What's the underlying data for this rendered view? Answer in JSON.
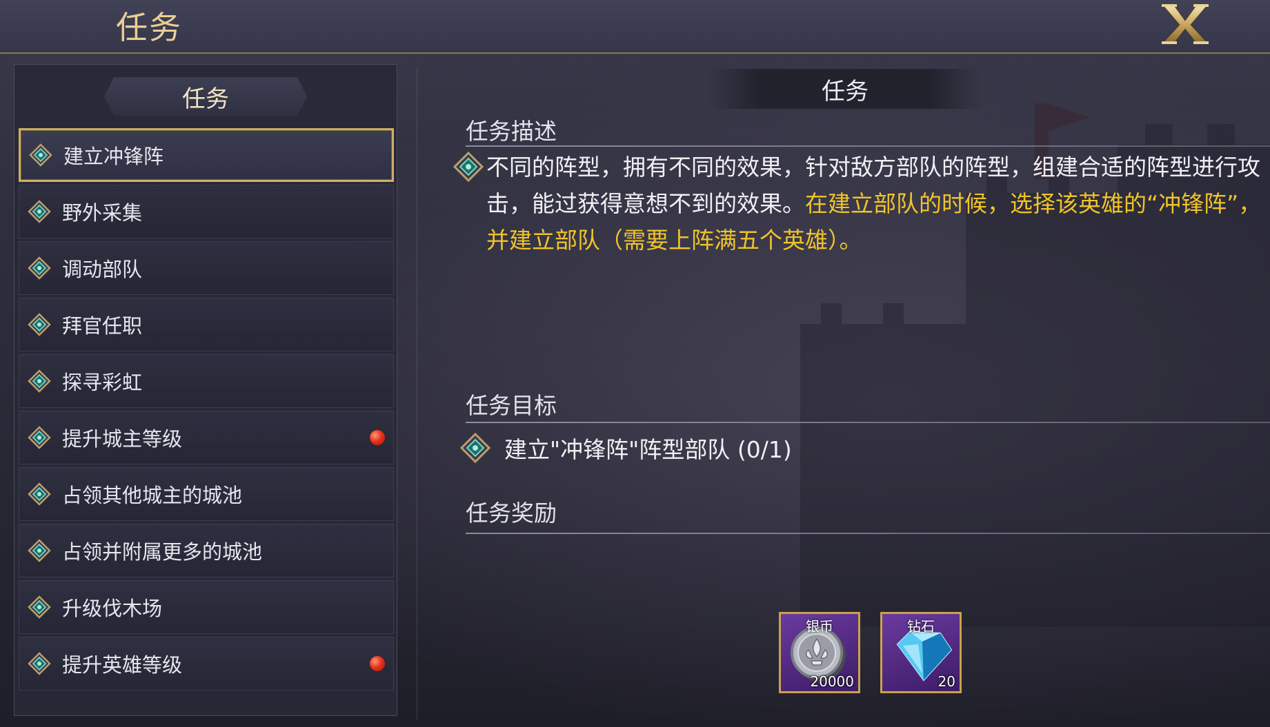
{
  "header": {
    "title": "任务"
  },
  "sidebar": {
    "heading": "任务",
    "items": [
      {
        "label": "建立冲锋阵",
        "active": true,
        "badge": false
      },
      {
        "label": "野外采集",
        "active": false,
        "badge": false
      },
      {
        "label": "调动部队",
        "active": false,
        "badge": false
      },
      {
        "label": "拜官任职",
        "active": false,
        "badge": false
      },
      {
        "label": "探寻彩虹",
        "active": false,
        "badge": false
      },
      {
        "label": "提升城主等级",
        "active": false,
        "badge": true
      },
      {
        "label": "占领其他城主的城池",
        "active": false,
        "badge": false
      },
      {
        "label": "占领并附属更多的城池",
        "active": false,
        "badge": false
      },
      {
        "label": "升级伐木场",
        "active": false,
        "badge": false
      },
      {
        "label": "提升英雄等级",
        "active": false,
        "badge": true
      }
    ]
  },
  "detail": {
    "heading": "任务",
    "description_title": "任务描述",
    "description_text": "不同的阵型，拥有不同的效果，针对敌方部队的阵型，组建合适的阵型进行攻击，能过获得意想不到的效果。",
    "description_highlight": "在建立部队的时候，选择该英雄的“冲锋阵”，并建立部队（需要上阵满五个英雄）。",
    "objective_title": "任务目标",
    "objective_text": "建立\"冲锋阵\"阵型部队 (0/1)",
    "reward_title": "任务奖励",
    "rewards": [
      {
        "name": "银币",
        "count": "20000",
        "icon": "silver-coin-icon"
      },
      {
        "name": "钻石",
        "count": "20",
        "icon": "diamond-gem-icon"
      }
    ]
  },
  "colors": {
    "accent_gold": "#cfae66",
    "highlight_text": "#f0c429",
    "badge_red": "#e8321a"
  }
}
